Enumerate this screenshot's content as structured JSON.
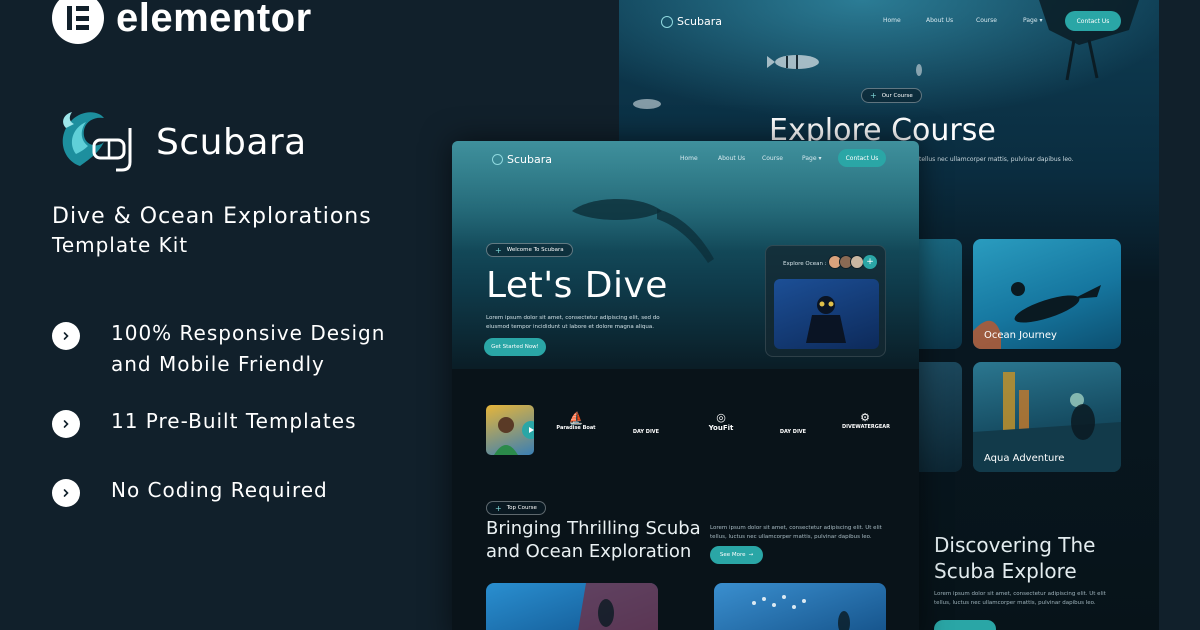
{
  "brand": {
    "name": "elementor"
  },
  "product": {
    "name": "Scubara",
    "tagline_line1": "Dive & Ocean Explorations",
    "tagline_line2": "Template Kit"
  },
  "features": [
    {
      "line1": "100% Responsive Design",
      "line2": "and Mobile Friendly"
    },
    {
      "line1": "11 Pre-Built Templates",
      "line2": ""
    },
    {
      "line1": "No Coding Required",
      "line2": ""
    }
  ],
  "site_nav": {
    "logo": "Scubara",
    "links": [
      "Home",
      "About Us",
      "Course",
      "Page"
    ],
    "cta": "Contact Us"
  },
  "back_page": {
    "pill": "Our Course",
    "title": "Explore Course",
    "subtitle": "tellus nec ullamcorper mattis, pulvinar dapibus leo.",
    "cards": [
      "Ocean Journey",
      "Aqua Adventure"
    ],
    "discover_line1": "Discovering The",
    "discover_line2": "Scuba Explore",
    "discover_body": "Lorem ipsum dolor sit amet, consectetur adipiscing elit. Ut elit tellus, luctus nec ullamcorper mattis, pulvinar dapibus leo."
  },
  "front_page": {
    "pill": "Welcome To Scubara",
    "title": "Let's Dive",
    "body": "Lorem ipsum dolor sit amet, consectetur adipiscing elit, sed do eiusmod tempor incididunt ut labore et dolore magna aliqua.",
    "button": "Get Started Now!",
    "explore_label": "Explore Ocean :",
    "partners": [
      "Paradise Boat",
      "DAY DIVE",
      "YouFit",
      "DAY DIVE",
      "DIVEWATERGEAR"
    ],
    "section_pill": "Top Course",
    "section_line1": "Bringing Thrilling Scuba",
    "section_line2": "and Ocean Exploration",
    "section_body": "Lorem ipsum dolor sit amet, consectetur adipiscing elit. Ut elit tellus, luctus nec ullamcorper mattis, pulvinar dapibus leo.",
    "section_button": "See More"
  },
  "colors": {
    "background": "#11202b",
    "accent": "#2aa6a6"
  }
}
